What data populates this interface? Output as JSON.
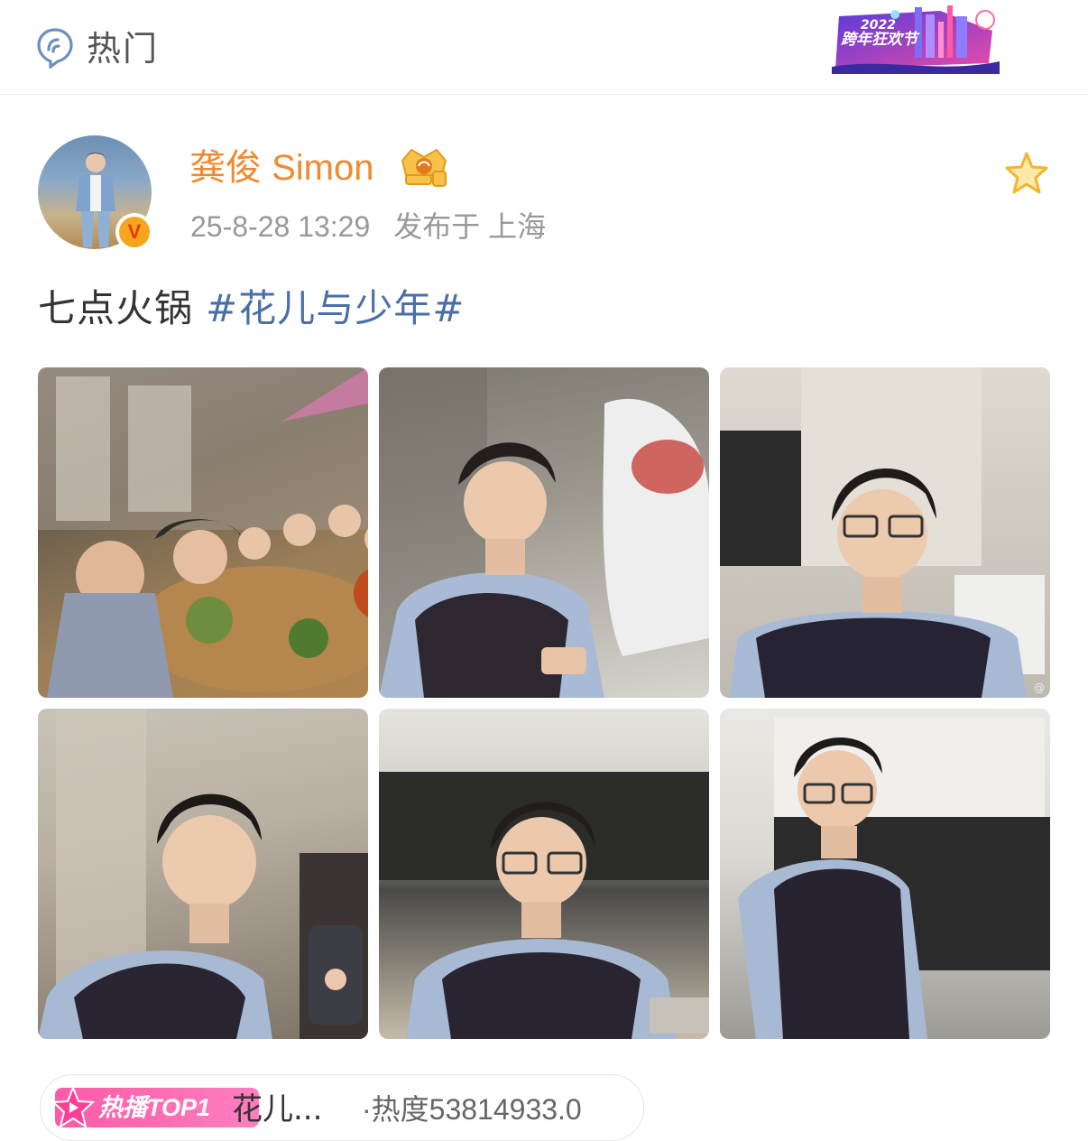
{
  "header": {
    "title": "热门",
    "promo_year": "2022",
    "promo_text": "跨年狂欢节"
  },
  "post": {
    "author": "龚俊 Simon",
    "timestamp": "25-8-28 13:29",
    "location": "发布于 上海",
    "text": "七点火锅",
    "hashtag": "#花儿与少年#",
    "photo_count": 6
  },
  "hot": {
    "badge": "热播TOP1",
    "title": "花儿...",
    "heat": "·热度53814933.0"
  },
  "colors": {
    "username": "#f08a2e",
    "hashtag": "#4a6ea8",
    "meta": "#999999",
    "badge": "#ff5aa8",
    "star": "#f5b52a"
  }
}
